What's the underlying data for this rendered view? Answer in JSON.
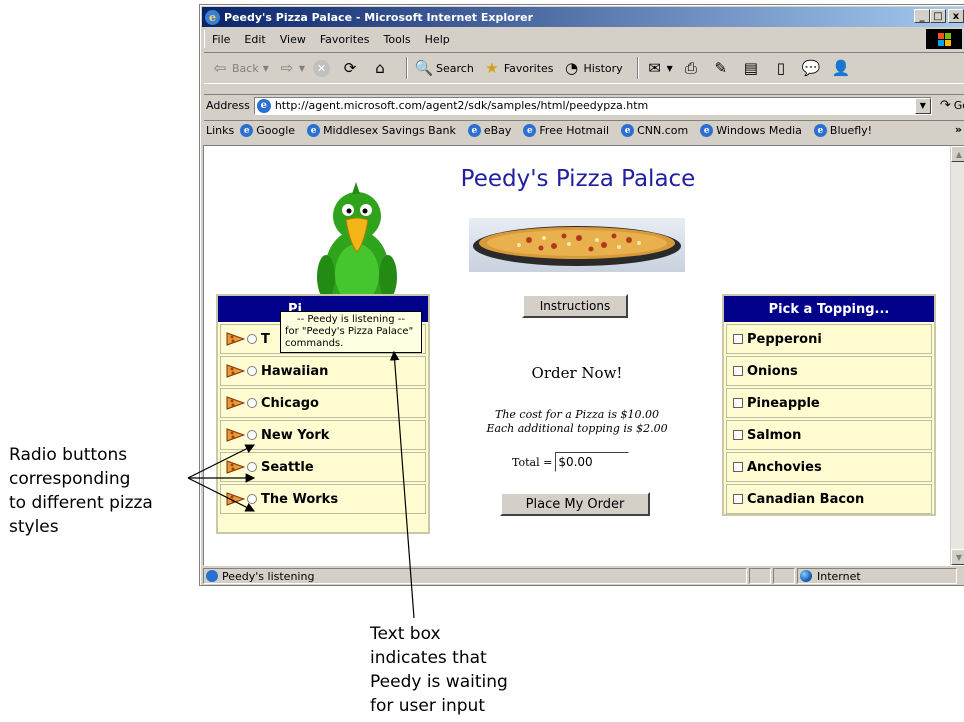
{
  "window": {
    "title": "Peedy's Pizza Palace - Microsoft Internet Explorer",
    "controls": [
      "_",
      "□",
      "x"
    ]
  },
  "menubar": [
    "File",
    "Edit",
    "View",
    "Favorites",
    "Tools",
    "Help"
  ],
  "toolbar": {
    "back": "Back",
    "search": "Search",
    "favorites": "Favorites",
    "history": "History"
  },
  "address": {
    "label": "Address",
    "url": "http://agent.microsoft.com/agent2/sdk/samples/html/peedypza.htm",
    "go": "Go"
  },
  "links": {
    "label": "Links",
    "items": [
      "Google",
      "Middlesex Savings Bank",
      "eBay",
      "Free Hotmail",
      "CNN.com",
      "Windows Media",
      "Bluefly!"
    ],
    "more": "»"
  },
  "page": {
    "title": "Peedy's Pizza Palace",
    "instructions_button": "Instructions",
    "order_now": "Order Now!",
    "cost_line1": "The cost for a Pizza is $10.00",
    "cost_line2": "Each additional topping is $2.00",
    "total_label": "Total =",
    "total_value": "$0.00",
    "place_order_button": "Place My Order"
  },
  "styles_panel": {
    "header": "Pick A Style",
    "header_visible": "Pi",
    "items": [
      "T",
      "Hawaiian",
      "Chicago",
      "New York",
      "Seattle",
      "The Works"
    ]
  },
  "toppings_panel": {
    "header": "Pick a Topping...",
    "items": [
      "Pepperoni",
      "Onions",
      "Pineapple",
      "Salmon",
      "Anchovies",
      "Canadian Bacon"
    ]
  },
  "tooltip": {
    "line1": "-- Peedy is listening --",
    "line2": "for \"Peedy's Pizza Palace\"",
    "line3": "commands."
  },
  "statusbar": {
    "text": "Peedy's listening",
    "zone": "Internet"
  },
  "annotations": {
    "radio_note": [
      "Radio buttons",
      "corresponding",
      "to different pizza",
      "styles"
    ],
    "textbox_note": [
      "Text box",
      "indicates that",
      "Peedy is waiting",
      "for user input"
    ]
  },
  "colors": {
    "panel_header": "#00008b",
    "panel_bg": "#fffcd2",
    "title_text": "#2020a0",
    "titlebar_start": "#0a246a"
  }
}
